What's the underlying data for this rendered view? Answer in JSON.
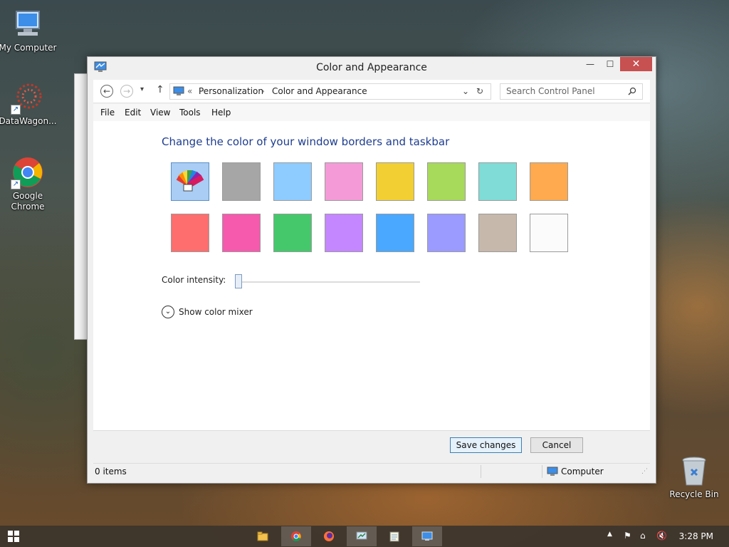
{
  "desktop": {
    "icons": [
      {
        "label": "My Computer"
      },
      {
        "label": "DataWagon..."
      },
      {
        "label": "Google Chrome"
      },
      {
        "label": "Recycle Bin"
      }
    ]
  },
  "window": {
    "title": "Color and Appearance",
    "controls": {
      "minimize": "—",
      "maximize": "☐",
      "close": "✕"
    },
    "breadcrumb": {
      "prefix": "«",
      "items": [
        "Personalization",
        "Color and Appearance"
      ],
      "separator": "›"
    },
    "search": {
      "placeholder": "Search Control Panel"
    },
    "menu": [
      "File",
      "Edit",
      "View",
      "Tools",
      "Help"
    ],
    "heading": "Change the color of your window borders and taskbar",
    "swatches_row1": [
      "auto",
      "#a6a6a6",
      "#8ecbff",
      "#f49bd7",
      "#f2cf33",
      "#a7d95a",
      "#7fdcd6",
      "#ffaa4e"
    ],
    "swatches_row2": [
      "#ff6e6e",
      "#f55aad",
      "#45c86c",
      "#c487ff",
      "#4aa8ff",
      "#9b9bff",
      "#c6b8ab",
      "#fbfbfb"
    ],
    "selected_swatch": "auto",
    "intensity": {
      "label": "Color intensity:",
      "value_fraction": 0.0
    },
    "mixer": {
      "label": "Show color mixer"
    },
    "buttons": {
      "save": "Save changes",
      "cancel": "Cancel"
    },
    "status": {
      "items": "0 items",
      "location": "Computer"
    }
  },
  "taskbar": {
    "time": "3:28 PM",
    "apps": [
      "file-explorer",
      "chrome",
      "firefox",
      "control-panel",
      "notepad",
      "personalization"
    ]
  },
  "colors": {
    "accent_heading": "#1e3d8f",
    "close_button": "#c75050",
    "default_button_border": "#3c7fb1"
  }
}
